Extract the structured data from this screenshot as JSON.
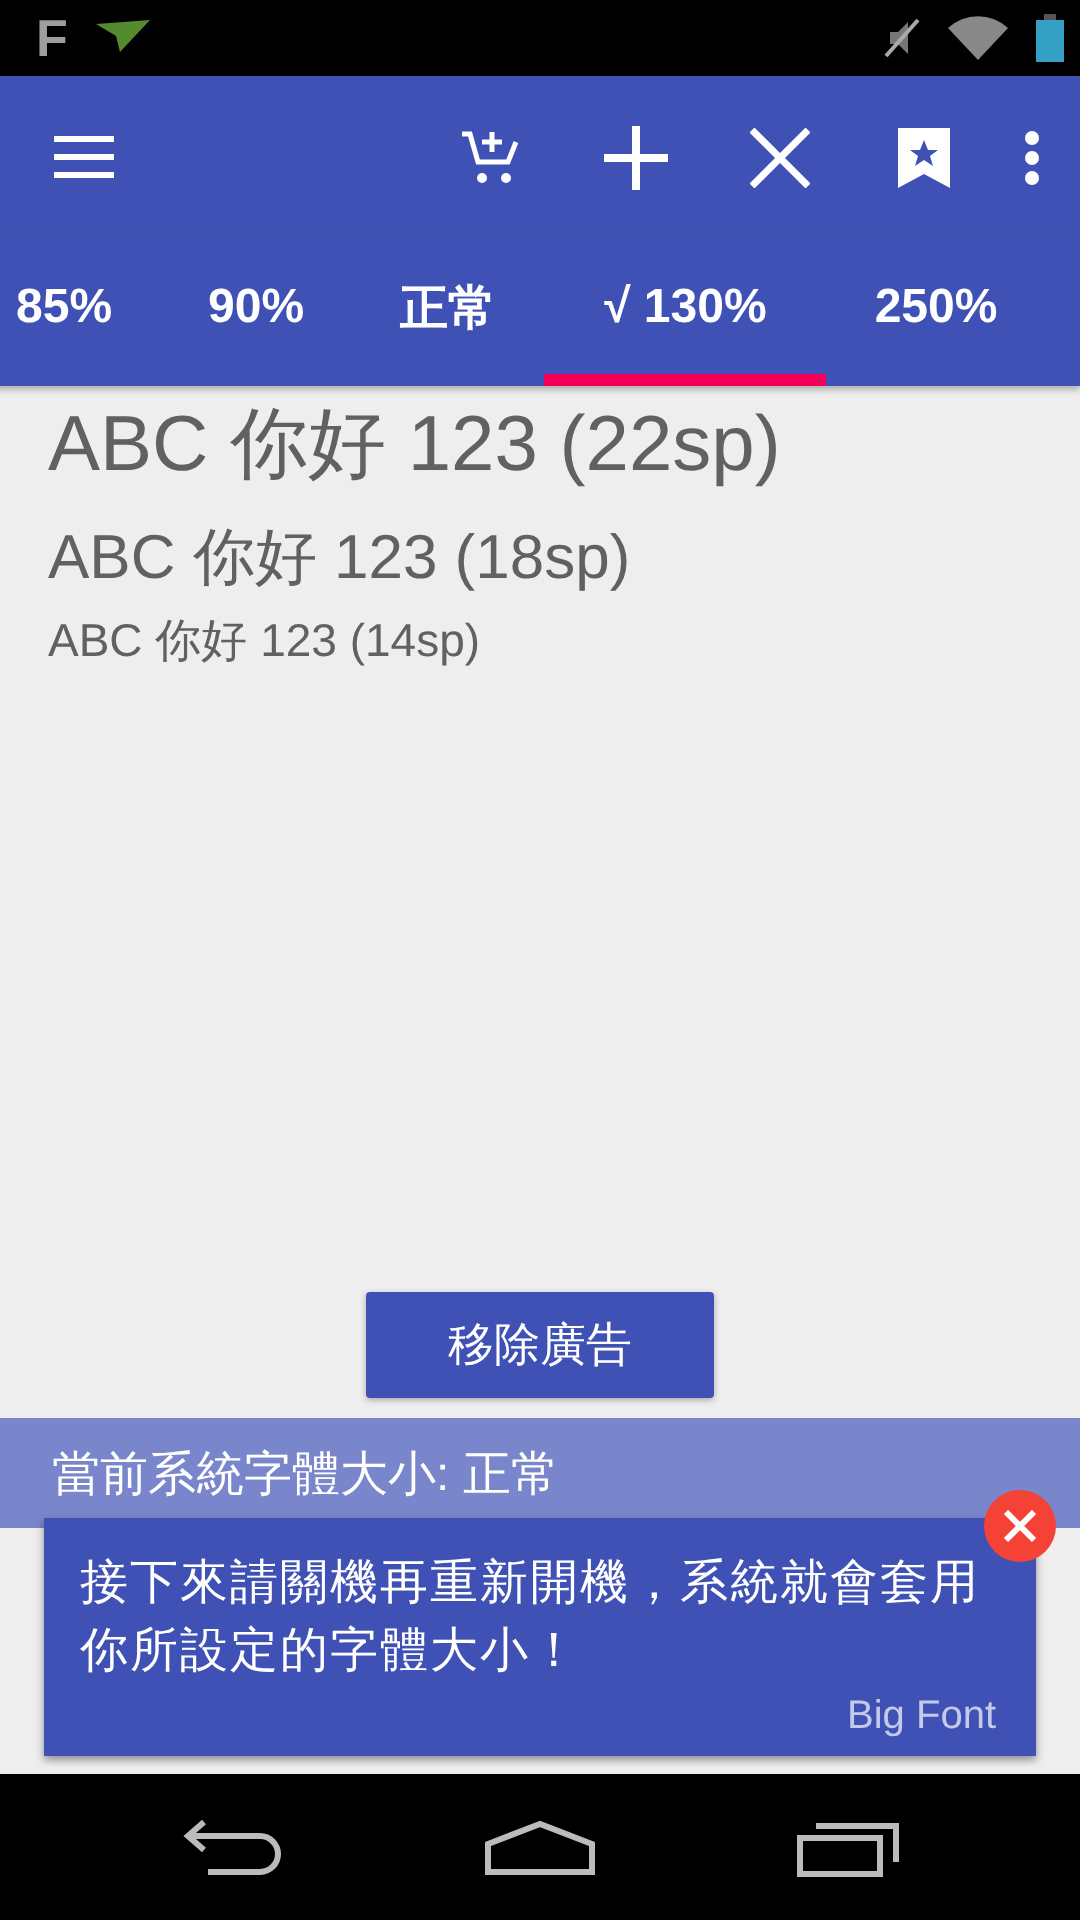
{
  "status_bar": {
    "app_letter": "F"
  },
  "tabs": [
    {
      "label": "85%",
      "selected": false
    },
    {
      "label": "90%",
      "selected": false
    },
    {
      "label": "正常",
      "selected": false
    },
    {
      "label": "√ 130%",
      "selected": true
    },
    {
      "label": "250%",
      "selected": false
    }
  ],
  "samples": [
    {
      "text": "ABC 你好 123 (22sp)",
      "kind": "large"
    },
    {
      "text": "ABC 你好 123 (18sp)",
      "kind": "medium"
    },
    {
      "text": "ABC 你好 123 (14sp)",
      "kind": "small"
    }
  ],
  "remove_ads_button": "移除廣告",
  "current_size_banner": "當前系統字體大小: 正常",
  "toast": {
    "message": "接下來請關機再重新開機，系統就會套用你所設定的字體大小！",
    "source": "Big Font"
  }
}
